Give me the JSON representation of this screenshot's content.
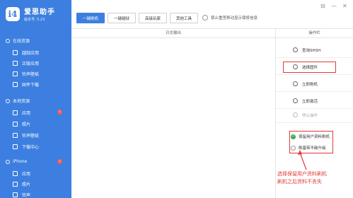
{
  "app": {
    "logo_glyph": "i4",
    "title": "爱思助手",
    "version": "版本号: 5.23"
  },
  "sidebar": {
    "sections": [
      {
        "label": "在线资源",
        "icon": "cloud-icon"
      },
      {
        "label": "本地资源",
        "icon": "folder-icon"
      },
      {
        "label": "iPhone",
        "icon": "phone-icon"
      }
    ],
    "online_items": [
      {
        "label": "越狱应用",
        "icon": "app-icon"
      },
      {
        "label": "正版应用",
        "icon": "store-icon"
      },
      {
        "label": "铃声壁纸",
        "icon": "music-icon"
      },
      {
        "label": "固件下载",
        "icon": "download-icon"
      }
    ],
    "local_items": [
      {
        "label": "应用",
        "icon": "app-icon",
        "badge": "!"
      },
      {
        "label": "照片",
        "icon": "photo-icon"
      },
      {
        "label": "铃声壁纸",
        "icon": "music-icon"
      },
      {
        "label": "下载中心",
        "icon": "download-icon"
      }
    ],
    "iphone_items": [
      {
        "label": "应用",
        "icon": "app-icon"
      },
      {
        "label": "照片",
        "icon": "photo-icon"
      },
      {
        "label": "铃声",
        "icon": "music-icon"
      }
    ],
    "iphone_badge": "!"
  },
  "toolbar": {
    "buttons": [
      "一键刷机",
      "一键越狱",
      "高级玩家",
      "其他工具"
    ],
    "option_label": "禁止重签移动显示保修信息",
    "window_controls": [
      "⊟",
      "—",
      "✕"
    ]
  },
  "log": {
    "header": "日志输出"
  },
  "actions": {
    "header": "操作栏",
    "items": [
      {
        "label": "查询SHSH",
        "icon": "search-icon",
        "enabled": true
      },
      {
        "label": "选择固件",
        "icon": "firmware-icon",
        "enabled": true
      },
      {
        "label": "立即刷机",
        "icon": "flash-icon",
        "enabled": true
      },
      {
        "label": "立即激活",
        "icon": "activate-icon",
        "enabled": true
      },
      {
        "label": "停止操作",
        "icon": "stop-icon",
        "enabled": false
      }
    ],
    "options": [
      {
        "label": "保留用户资料刷机",
        "checked": true
      },
      {
        "label": "刷基带不破升级",
        "checked": false
      }
    ]
  },
  "annotation": {
    "text_line1": "选择保留用户资料刷机",
    "text_line2": "刷机之后资料不丢失",
    "color": "#e03a3a"
  },
  "colors": {
    "brand": "#3d7fe0",
    "alert": "#e03a3a",
    "check": "#36b04b"
  }
}
